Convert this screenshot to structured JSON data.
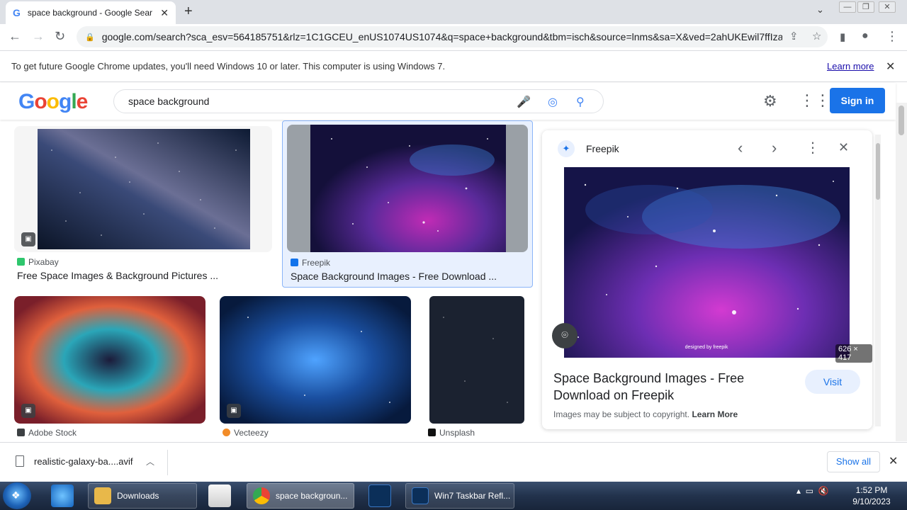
{
  "browser": {
    "tab_title": "space background - Google Sear",
    "tab_favicon": "G",
    "url": "google.com/search?sca_esv=564185751&rlz=1C1GCEU_enUS1074US1074&q=space+background&tbm=isch&source=lnms&sa=X&ved=2ahUKEwil7ffIza...",
    "infobar_message": "To get future Google Chrome updates, you'll need Windows 10 or later. This computer is using Windows 7.",
    "infobar_link": "Learn more"
  },
  "google": {
    "logo_letters": [
      "G",
      "o",
      "o",
      "g",
      "l",
      "e"
    ],
    "logo_colors": [
      "#4285f4",
      "#ea4335",
      "#fbbc05",
      "#4285f4",
      "#34a853",
      "#ea4335"
    ],
    "query": "space background",
    "signin_label": "Sign in"
  },
  "results": {
    "top": [
      {
        "source": "Pixabay",
        "title": "Free Space Images & Background Pictures ...",
        "fav_color": "#2ec66d"
      },
      {
        "source": "Freepik",
        "title": "Space Background Images - Free Download ...",
        "fav_color": "#1273eb"
      }
    ],
    "bottom": [
      {
        "source": "Adobe Stock",
        "fav_color": "#3c4043"
      },
      {
        "source": "Vecteezy",
        "fav_color": "#f28c28"
      },
      {
        "source": "Unsplash",
        "fav_color": "#111111"
      }
    ]
  },
  "panel": {
    "source": "Freepik",
    "title": "Space Background Images - Free Download on Freepik",
    "visit_label": "Visit",
    "copyright_text": "Images may be subject to copyright.",
    "copyright_link": "Learn More",
    "dimensions": "626 × 417",
    "watermark": "designed by freepik"
  },
  "download_bar": {
    "file_name": "realistic-galaxy-ba....avif",
    "show_all_label": "Show all"
  },
  "taskbar": {
    "items": [
      {
        "label": "Downloads",
        "icon_color": "#e8b84a"
      },
      {
        "label": "space backgroun...",
        "icon_color": "#e34133"
      },
      {
        "label": "Win7 Taskbar Refl...",
        "icon_color": "#0b2f59"
      }
    ],
    "time": "1:52 PM",
    "date": "9/10/2023"
  }
}
